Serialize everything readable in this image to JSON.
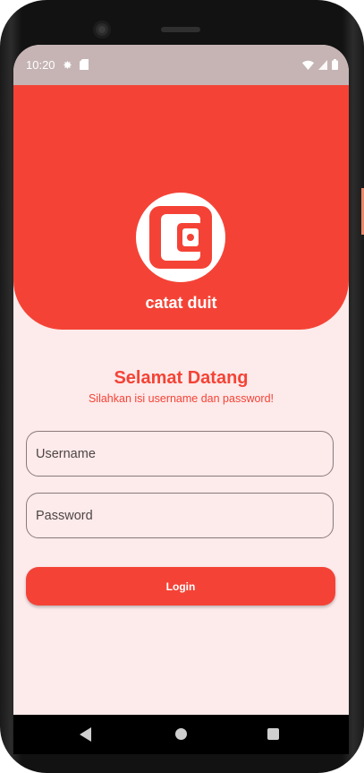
{
  "status_bar": {
    "time": "10:20"
  },
  "header": {
    "app_name": "catat duit",
    "logo_icon": "wallet-icon"
  },
  "login": {
    "title": "Selamat Datang",
    "subtitle": "Silahkan isi username dan password!",
    "username_placeholder": "Username",
    "password_placeholder": "Password",
    "login_label": "Login"
  },
  "colors": {
    "primary": "#f44336",
    "background": "#fdeaea",
    "status_bar": "#c6b4b4"
  }
}
